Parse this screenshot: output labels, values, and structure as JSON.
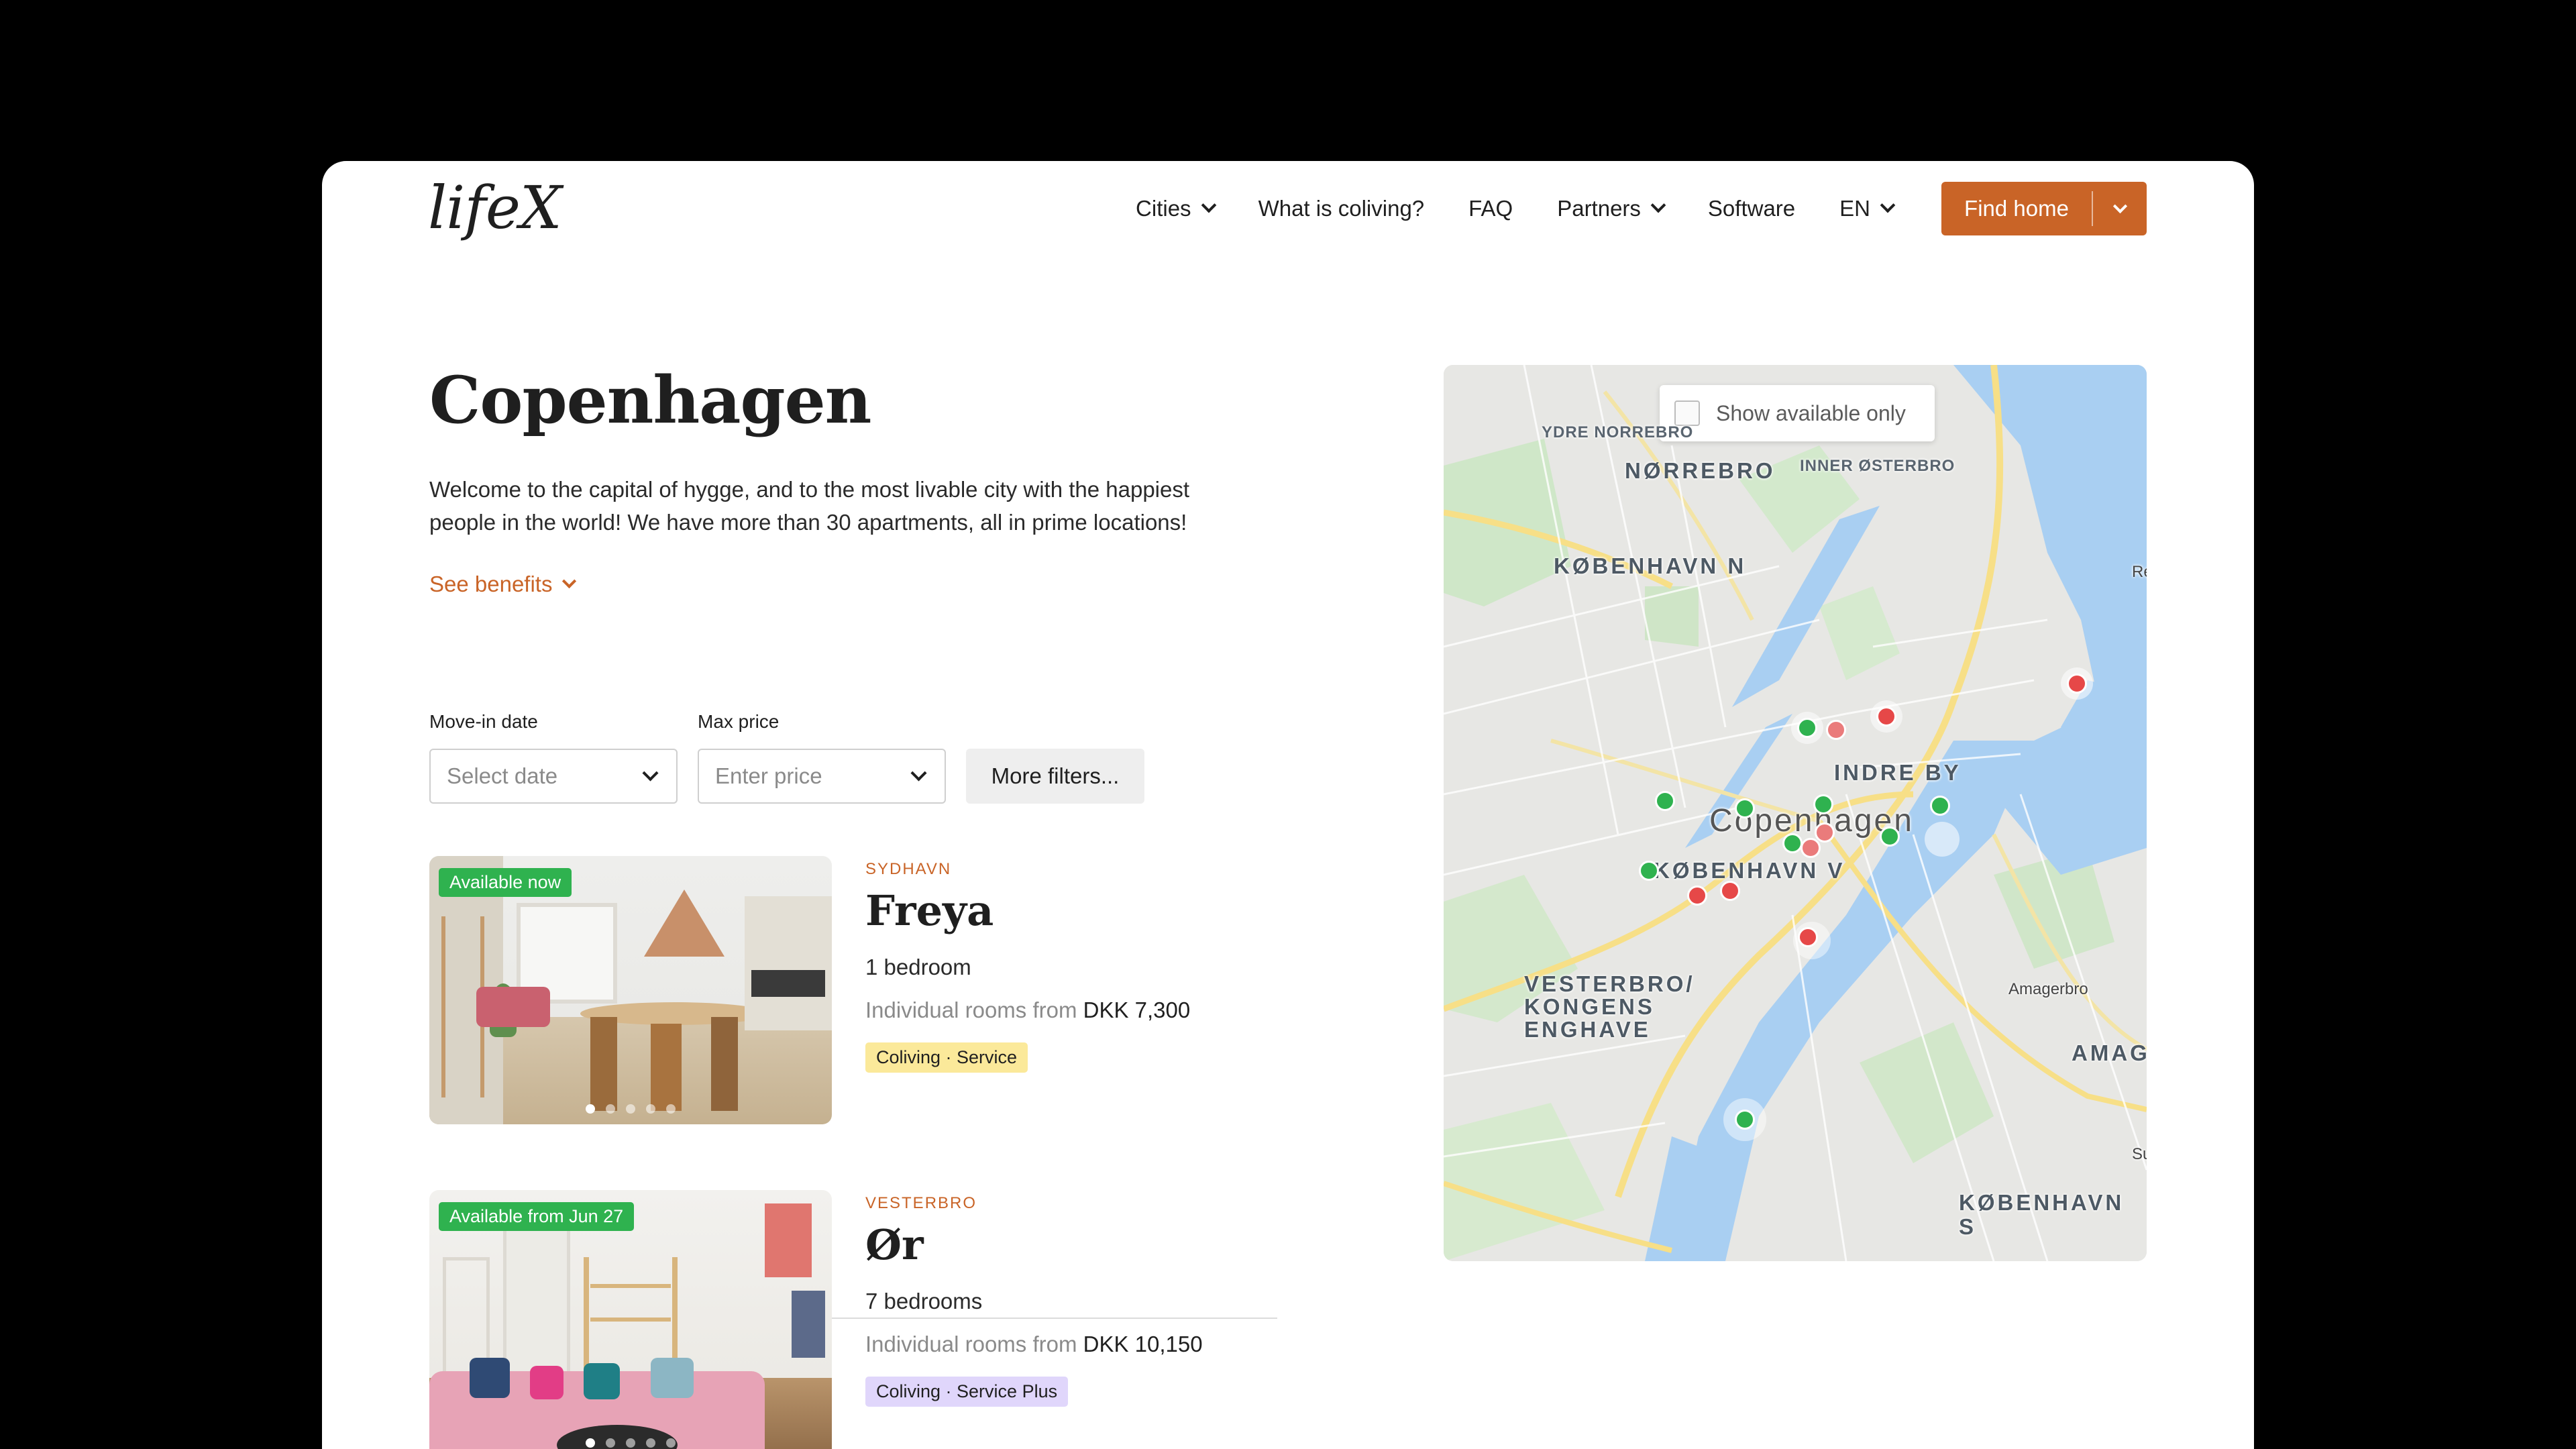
{
  "brand": {
    "logo": "lifeX",
    "accent": "#c96427",
    "available_green": "#2fb24f",
    "unavailable_red": "#e64848"
  },
  "nav": {
    "items": [
      {
        "label": "Cities",
        "dropdown": true
      },
      {
        "label": "What is coliving?",
        "dropdown": false
      },
      {
        "label": "FAQ",
        "dropdown": false
      },
      {
        "label": "Partners",
        "dropdown": true
      },
      {
        "label": "Software",
        "dropdown": false
      },
      {
        "label": "EN",
        "dropdown": true
      }
    ],
    "cta_label": "Find home"
  },
  "hero": {
    "title": "Copenhagen",
    "intro": "Welcome to the capital of hygge, and to the most livable city with the happiest people in the world! We have more than 30 apartments, all in prime locations!",
    "benefits_link": "See benefits"
  },
  "filters": {
    "move_in": {
      "label": "Move-in date",
      "placeholder": "Select date"
    },
    "max_price": {
      "label": "Max price",
      "placeholder": "Enter price"
    },
    "more_label": "More filters..."
  },
  "listings": [
    {
      "availability": "Available now",
      "neighborhood": "SYDHAVN",
      "name": "Freya",
      "bedrooms": "1 bedroom",
      "price_prefix": "Individual rooms from",
      "price": "DKK 7,300",
      "tag": "Coliving · Service",
      "tag_color": "#fbe99a",
      "photo_count": 5,
      "active_photo": 0
    },
    {
      "availability": "Available from Jun 27",
      "neighborhood": "VESTERBRO",
      "name": "Ør",
      "bedrooms": "7 bedrooms",
      "price_prefix": "Individual rooms from",
      "price": "DKK 10,150",
      "tag": "Coliving · Service Plus",
      "tag_color": "#e0d6fb",
      "photo_count": 5,
      "active_photo": 0
    }
  ],
  "map": {
    "available_only_label": "Show available only",
    "labels": {
      "ydre_norrebro": "YDRE NORREBRO",
      "norrebro": "NØRREBRO",
      "inner_osterbro": "INNER ØSTERBRO",
      "kobenhavn_n": "KØBENHAVN N",
      "indre_by": "INDRE BY",
      "copenhagen": "Copenhagen",
      "kobenhavn_v": "KØBENHAVN V",
      "vesterbro": "VESTERBRO/\nKONGENS\nENGHAVE",
      "amagerbro": "Amagerbro",
      "amager": "AMAGER",
      "kobenhavn_s": "KØBENHAVN S",
      "edge_r": "Re",
      "edge_s": "Su"
    }
  }
}
